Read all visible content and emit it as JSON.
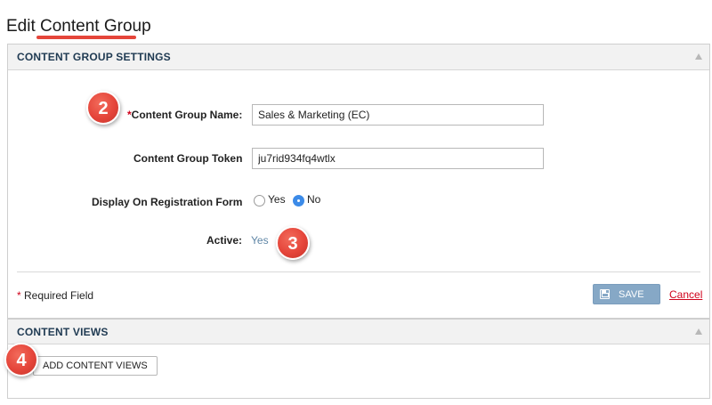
{
  "page": {
    "title": "Edit Content Group"
  },
  "settings_panel": {
    "header": "CONTENT GROUP SETTINGS",
    "name_required_star": "*",
    "name_label": "Content Group Name:",
    "name_value": "Sales & Marketing (EC)",
    "token_label": "Content Group Token",
    "token_value": "ju7rid934fq4wtlx",
    "display_label": "Display On Registration Form",
    "display_options": [
      "Yes",
      "No"
    ],
    "display_selected": "No",
    "active_label": "Active:",
    "active_value": "Yes",
    "required_star": "*",
    "required_note": "Required Field",
    "save_label": "SAVE",
    "cancel_label": "Cancel"
  },
  "views_panel": {
    "header": "CONTENT VIEWS",
    "add_button_label": "ADD CONTENT VIEWS"
  },
  "callouts": [
    "2",
    "3",
    "4"
  ],
  "colors": {
    "accent_red": "#e5453a",
    "header_text": "#1f3a52",
    "save_button": "#86a8c6",
    "radio_selected": "#3c8be8",
    "link_red": "#d0021b"
  }
}
